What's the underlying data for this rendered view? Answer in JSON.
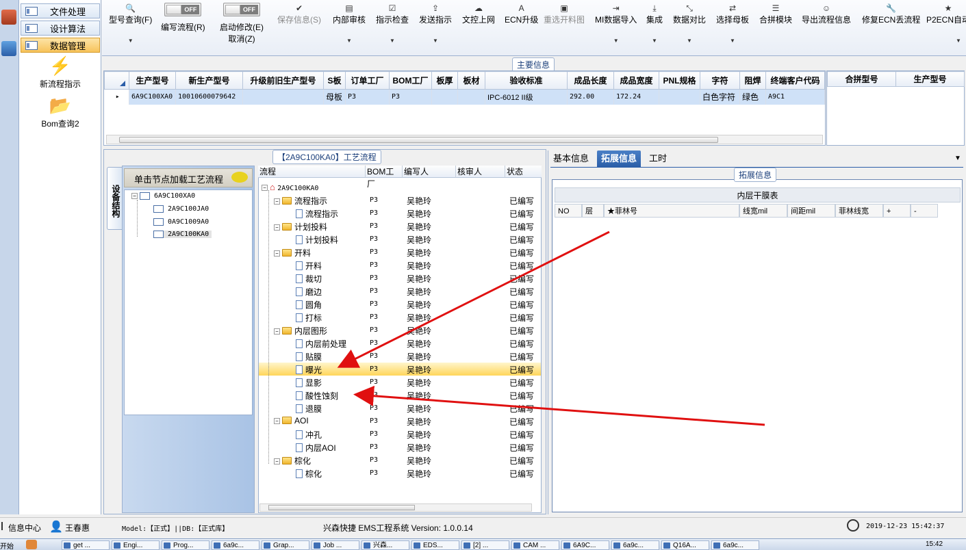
{
  "nav": {
    "items": [
      {
        "label": "文件处理"
      },
      {
        "label": "设计算法"
      },
      {
        "label": "数据管理"
      }
    ],
    "big": [
      {
        "label": "新流程指示"
      },
      {
        "label": "Bom查询2"
      }
    ]
  },
  "toolbar": {
    "items": [
      {
        "label": "型号查询(F)"
      },
      {
        "label": "编写流程(R)",
        "toggle": "OFF"
      },
      {
        "label": "启动修改(E)",
        "label2": "取消(Z)",
        "toggle": "OFF"
      },
      {
        "label": "保存信息(S)"
      },
      {
        "label": "内部审核"
      },
      {
        "label": "指示检查"
      },
      {
        "label": "发送指示"
      },
      {
        "label": "文控上网"
      },
      {
        "label": "ECN升级"
      },
      {
        "label": "重选开料图"
      },
      {
        "label": "MI数据导入"
      },
      {
        "label": "集成"
      },
      {
        "label": "数据对比"
      },
      {
        "label": "选择母板"
      },
      {
        "label": "合拼模块"
      },
      {
        "label": "导出流程信息"
      },
      {
        "label": "修复ECN丢流程"
      },
      {
        "label": "P2ECN自动"
      }
    ]
  },
  "main_info": {
    "title": "主要信息",
    "columns": [
      "生产型号",
      "新生产型号",
      "升级前旧生产型号",
      "S板",
      "订单工厂",
      "BOM工厂",
      "板厚",
      "板材",
      "验收标准",
      "成品长度",
      "成品宽度",
      "PNL规格",
      "字符",
      "阻焊",
      "终端客户代码"
    ],
    "row": [
      "6A9C100XA0",
      "10010600079642",
      "",
      "母板",
      "P3",
      "P3",
      "",
      "",
      "IPC-6012 II级",
      "292.00",
      "172.24",
      "",
      "白色字符",
      "绿色",
      "A9C1"
    ],
    "merge_columns": [
      "合拼型号",
      "生产型号"
    ]
  },
  "process": {
    "title": "【2A9C100KA0】工艺流程",
    "vtab": "设备结构",
    "hint": "单击节点加载工艺流程",
    "device_tree": [
      {
        "label": "6A9C100XA0"
      },
      {
        "label": "2A9C100JA0"
      },
      {
        "label": "0A9C1009A0"
      },
      {
        "label": "2A9C100KA0"
      }
    ],
    "columns": [
      "流程",
      "BOM工厂",
      "编写人",
      "核审人",
      "状态"
    ],
    "root": "2A9C100KA0",
    "rows": [
      {
        "name": "流程指示",
        "bom": "P3",
        "writer": "吴艳玲",
        "status": "已编写"
      },
      {
        "name": "流程指示",
        "bom": "P3",
        "writer": "吴艳玲",
        "status": "已编写"
      },
      {
        "name": "计划投料",
        "bom": "P3",
        "writer": "吴艳玲",
        "status": "已编写"
      },
      {
        "name": "计划投料",
        "bom": "P3",
        "writer": "吴艳玲",
        "status": "已编写"
      },
      {
        "name": "开料",
        "bom": "P3",
        "writer": "吴艳玲",
        "status": "已编写"
      },
      {
        "name": "开料",
        "bom": "P3",
        "writer": "吴艳玲",
        "status": "已编写"
      },
      {
        "name": "裁切",
        "bom": "P3",
        "writer": "吴艳玲",
        "status": "已编写"
      },
      {
        "name": "磨边",
        "bom": "P3",
        "writer": "吴艳玲",
        "status": "已编写"
      },
      {
        "name": "圆角",
        "bom": "P3",
        "writer": "吴艳玲",
        "status": "已编写"
      },
      {
        "name": "打标",
        "bom": "P3",
        "writer": "吴艳玲",
        "status": "已编写"
      },
      {
        "name": "内层图形",
        "bom": "P3",
        "writer": "吴艳玲",
        "status": "已编写"
      },
      {
        "name": "内层前处理",
        "bom": "P3",
        "writer": "吴艳玲",
        "status": "已编写"
      },
      {
        "name": "贴膜",
        "bom": "P3",
        "writer": "吴艳玲",
        "status": "已编写"
      },
      {
        "name": "曝光",
        "bom": "P3",
        "writer": "吴艳玲",
        "status": "已编写"
      },
      {
        "name": "显影",
        "bom": "P3",
        "writer": "吴艳玲",
        "status": "已编写"
      },
      {
        "name": "酸性蚀刻",
        "bom": "P3",
        "writer": "吴艳玲",
        "status": "已编写"
      },
      {
        "name": "退膜",
        "bom": "P3",
        "writer": "吴艳玲",
        "status": "已编写"
      },
      {
        "name": "AOI",
        "bom": "P3",
        "writer": "吴艳玲",
        "status": "已编写"
      },
      {
        "name": "冲孔",
        "bom": "P3",
        "writer": "吴艳玲",
        "status": "已编写"
      },
      {
        "name": "内层AOI",
        "bom": "P3",
        "writer": "吴艳玲",
        "status": "已编写"
      },
      {
        "name": "棕化",
        "bom": "P3",
        "writer": "吴艳玲",
        "status": "已编写"
      },
      {
        "name": "棕化",
        "bom": "P3",
        "writer": "吴艳玲",
        "status": "已编写"
      }
    ]
  },
  "right": {
    "tabs": [
      "基本信息",
      "拓展信息",
      "工时"
    ],
    "group_title": "拓展信息",
    "table_title": "内层干膜表",
    "columns": [
      "NO",
      "层",
      "★菲林号",
      "线宽mil",
      "间距mil",
      "菲林线宽",
      "+",
      "-"
    ]
  },
  "status": {
    "info_center": "信息中心",
    "user": "王春惠",
    "model": "Model:【正式】||DB:【正式库】",
    "app": "兴森快捷 EMS工程系统 Version: 1.0.0.14",
    "datetime": "2019-12-23 15:42:37"
  },
  "taskbar": {
    "start": "开始",
    "items": [
      "get ...",
      "Engi...",
      "Prog...",
      "6a9c...",
      "Grap...",
      "Job ...",
      "兴森...",
      "EDS...",
      "[2] ...",
      "CAM ...",
      "6A9C...",
      "6a9c...",
      "Q16A...",
      "6a9c..."
    ],
    "clock": "15:42"
  }
}
